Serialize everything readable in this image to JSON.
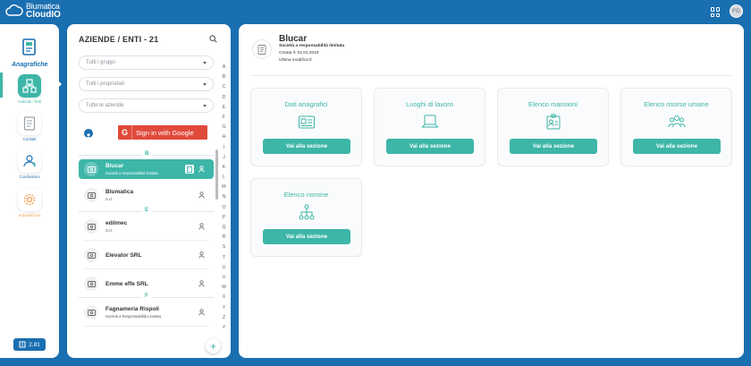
{
  "app": {
    "name_line1": "Blumatica",
    "name_line2": "CloudIO",
    "user_initials": "FG"
  },
  "sidebar": {
    "module_label": "Anagrafiche",
    "items": [
      {
        "label": "Aziende / Enti",
        "icon": "company-tree-icon",
        "active": true
      },
      {
        "label": "Contatti",
        "icon": "contacts-icon",
        "active": false
      },
      {
        "label": "Condivisioni",
        "icon": "share-icon",
        "active": false
      },
      {
        "label": "Impostazioni",
        "icon": "gear-icon",
        "active": false
      }
    ],
    "version": "2.81"
  },
  "list": {
    "title": "AZIENDE / ENTI - 21",
    "filters": {
      "groups": "Tutti i gruppi",
      "owners": "Tutti i proprietari",
      "companies": "Tutte le aziende"
    },
    "google_button": "Sign in with Google",
    "sections": [
      {
        "letter": "B",
        "rows": [
          {
            "name": "Blucar",
            "sub": "Società a responsabilità limitata",
            "selected": true
          },
          {
            "name": "Blumatica",
            "sub": "S.r.l.",
            "selected": false
          }
        ]
      },
      {
        "letter": "E",
        "rows": [
          {
            "name": "edilmec",
            "sub": "S.r.l.",
            "selected": false
          },
          {
            "name": "Elevator SRL",
            "sub": "",
            "selected": false
          },
          {
            "name": "Emme effe SRL",
            "sub": "",
            "selected": false
          }
        ]
      },
      {
        "letter": "F",
        "rows": [
          {
            "name": "Fagnameria Rispoli",
            "sub": "Società a Responsabilità Limitata",
            "selected": false
          }
        ]
      }
    ],
    "alphabet": [
      "A",
      "B",
      "C",
      "D",
      "E",
      "F",
      "G",
      "H",
      "I",
      "J",
      "K",
      "L",
      "M",
      "N",
      "O",
      "P",
      "Q",
      "R",
      "S",
      "T",
      "U",
      "V",
      "W",
      "X",
      "Y",
      "Z",
      "#"
    ],
    "add_label": "+"
  },
  "detail": {
    "name": "Blucar",
    "legal_form": "Società a responsabilità limitata",
    "created": "Creata il: 02.01.2019",
    "modified": "Ultima modifica il:",
    "cards": [
      {
        "title": "Dati anagrafici",
        "button": "Vai alla sezione",
        "icon": "id-card-icon"
      },
      {
        "title": "Luoghi di lavoro",
        "button": "Vai alla sezione",
        "icon": "workplace-icon"
      },
      {
        "title": "Elenco mansioni",
        "button": "Vai alla sezione",
        "icon": "badge-icon"
      },
      {
        "title": "Elenco risorse umane",
        "button": "Vai alla sezione",
        "icon": "people-icon"
      },
      {
        "title": "Elenco nomine",
        "button": "Vai alla sezione",
        "icon": "org-chart-icon"
      }
    ]
  },
  "colors": {
    "brand": "#1a6fb0",
    "accent": "#3db6a8",
    "google": "#e04a3a"
  }
}
